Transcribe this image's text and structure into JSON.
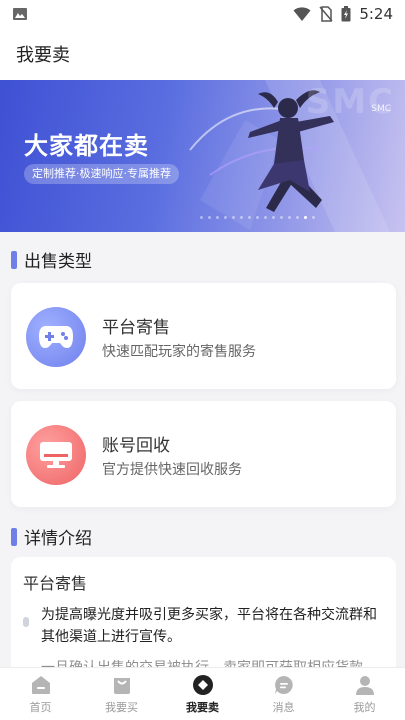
{
  "status_bar": {
    "time": "5:24"
  },
  "header": {
    "title": "我要卖"
  },
  "banner": {
    "title": "大家都在卖",
    "subtitle": "定制推荐·极速响应·专属推荐",
    "brand_large": "SMC",
    "brand_small": "SMC"
  },
  "sections": {
    "sale_types": "出售类型",
    "details": "详情介绍"
  },
  "cards": [
    {
      "title": "平台寄售",
      "desc": "快速匹配玩家的寄售服务",
      "icon": "gamepad-icon"
    },
    {
      "title": "账号回收",
      "desc": "官方提供快速回收服务",
      "icon": "monitor-icon"
    }
  ],
  "detail": {
    "title": "平台寄售",
    "items": [
      "为提高曝光度并吸引更多买家，平台将在各种交流群和其他渠道上进行宣传。",
      "一旦确认出售的交易被执行，卖家即可获取相应货款。"
    ]
  },
  "nav": [
    {
      "label": "首页",
      "icon": "home-icon"
    },
    {
      "label": "我要买",
      "icon": "shopping-bag-icon"
    },
    {
      "label": "我要卖",
      "icon": "sell-icon"
    },
    {
      "label": "消息",
      "icon": "message-icon"
    },
    {
      "label": "我的",
      "icon": "user-icon"
    }
  ],
  "colors": {
    "accent": "#6f7fe8",
    "platform_icon": "#7a8df0",
    "recycle_icon": "#f06b6b"
  }
}
